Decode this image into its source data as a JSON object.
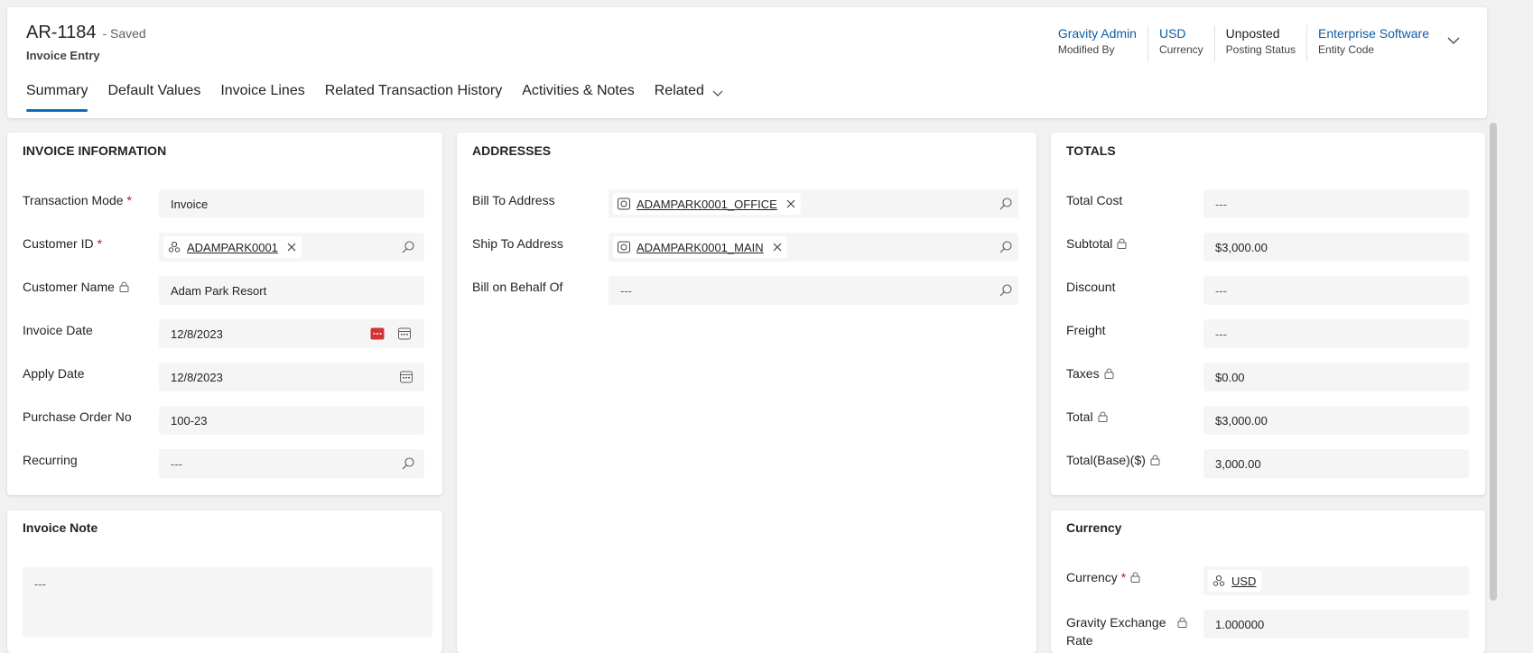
{
  "record": {
    "name": "AR-1184",
    "status": "- Saved",
    "form": "Invoice Entry"
  },
  "header_fields": [
    {
      "value": "Gravity Admin",
      "label": "Modified By"
    },
    {
      "value": "USD",
      "label": "Currency"
    },
    {
      "value": "Unposted",
      "label": "Posting Status"
    },
    {
      "value": "Enterprise Software",
      "label": "Entity Code"
    }
  ],
  "tabs": [
    "Summary",
    "Default Values",
    "Invoice Lines",
    "Related Transaction History",
    "Activities & Notes",
    "Related"
  ],
  "invoice_info": {
    "title": "INVOICE INFORMATION",
    "transaction_mode": {
      "label": "Transaction Mode",
      "value": "Invoice"
    },
    "customer_id": {
      "label": "Customer ID",
      "value": "ADAMPARK0001"
    },
    "customer_name": {
      "label": "Customer Name",
      "value": "Adam Park Resort"
    },
    "invoice_date": {
      "label": "Invoice Date",
      "value": "12/8/2023"
    },
    "apply_date": {
      "label": "Apply Date",
      "value": "12/8/2023"
    },
    "po_no": {
      "label": "Purchase Order No",
      "value": "100-23"
    },
    "recurring": {
      "label": "Recurring",
      "value": "---"
    }
  },
  "invoice_note": {
    "title": "Invoice Note",
    "value": "---"
  },
  "addresses": {
    "title": "ADDRESSES",
    "bill_to": {
      "label": "Bill To Address",
      "value": "ADAMPARK0001_OFFICE"
    },
    "ship_to": {
      "label": "Ship To Address",
      "value": "ADAMPARK0001_MAIN"
    },
    "behalf": {
      "label": "Bill on Behalf Of",
      "value": "---"
    }
  },
  "totals": {
    "title": "TOTALS",
    "total_cost": {
      "label": "Total Cost",
      "value": "---"
    },
    "subtotal": {
      "label": "Subtotal",
      "value": "$3,000.00"
    },
    "discount": {
      "label": "Discount",
      "value": "---"
    },
    "freight": {
      "label": "Freight",
      "value": "---"
    },
    "taxes": {
      "label": "Taxes",
      "value": "$0.00"
    },
    "total": {
      "label": "Total",
      "value": "$3,000.00"
    },
    "total_base": {
      "label": "Total(Base)($)",
      "value": "3,000.00"
    }
  },
  "currency_section": {
    "title": "Currency",
    "currency": {
      "label": "Currency",
      "value": "USD"
    },
    "rate": {
      "label_line1": "Gravity Exchange",
      "label_line2": "Rate",
      "value": "1.000000"
    }
  },
  "required_mark": "*",
  "colors": {
    "accent": "#0f6cbd",
    "link": "#115ea3",
    "required": "#c50f1f",
    "calendar_alert": "#d13438"
  }
}
